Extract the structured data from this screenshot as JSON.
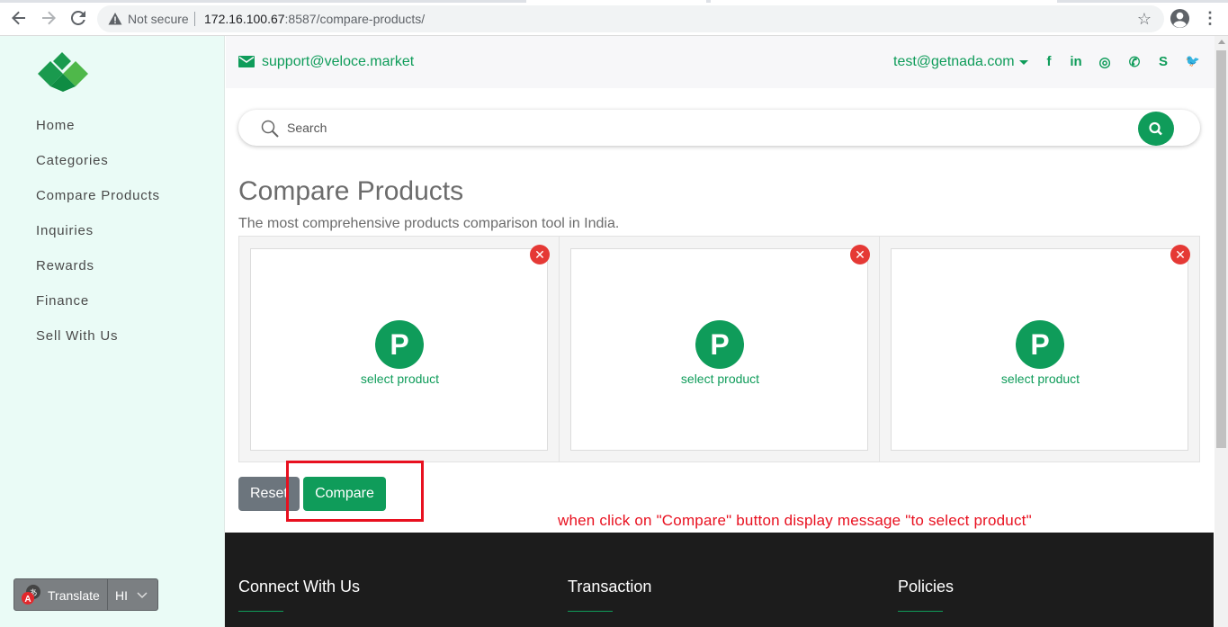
{
  "browser": {
    "security_label": "Not secure",
    "url_host": "172.16.100.67",
    "url_path": ":8587/compare-products/"
  },
  "sidebar": {
    "items": [
      {
        "label": "Home"
      },
      {
        "label": "Categories"
      },
      {
        "label": "Compare Products"
      },
      {
        "label": "Inquiries"
      },
      {
        "label": "Rewards"
      },
      {
        "label": "Finance"
      },
      {
        "label": "Sell With Us"
      }
    ],
    "translate": {
      "label": "Translate",
      "lang": "HI"
    }
  },
  "topbar": {
    "support_email": "support@veloce.market",
    "user_email": "test@getnada.com",
    "social_icons": [
      "facebook-icon",
      "linkedin-icon",
      "instagram-icon",
      "whatsapp-icon",
      "skype-icon",
      "twitter-icon"
    ],
    "social_glyphs": [
      "f",
      "in",
      "◎",
      "✆",
      "S",
      "🐦"
    ]
  },
  "search": {
    "placeholder": "Search"
  },
  "main": {
    "title": "Compare Products",
    "subtitle": "The most comprehensive products comparison tool in India.",
    "slots": [
      {
        "icon_letter": "P",
        "label": "select product"
      },
      {
        "icon_letter": "P",
        "label": "select product"
      },
      {
        "icon_letter": "P",
        "label": "select product"
      }
    ],
    "reset_label": "Reset",
    "compare_label": "Compare"
  },
  "annotation": {
    "text": "when click on \"Compare\" button display message \"to select product\""
  },
  "footer": {
    "headings": [
      "Connect With Us",
      "Transaction",
      "Policies"
    ]
  },
  "colors": {
    "brand": "#0f9c5a",
    "sidebar_bg": "#eafbf6",
    "annotation": "#e8101f",
    "footer_bg": "#1c1c1c"
  }
}
